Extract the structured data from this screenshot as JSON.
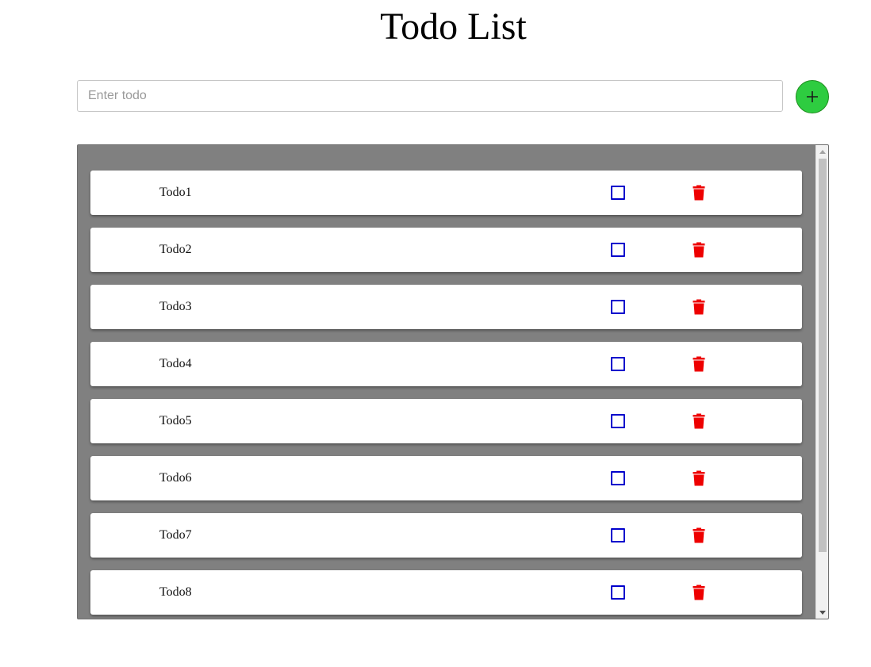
{
  "page": {
    "title": "Todo List"
  },
  "input": {
    "placeholder": "Enter todo",
    "value": ""
  },
  "add_button": {
    "icon": "plus-icon",
    "color": "#2ecc40"
  },
  "todos": [
    {
      "label": "Todo1",
      "done": false
    },
    {
      "label": "Todo2",
      "done": false
    },
    {
      "label": "Todo3",
      "done": false
    },
    {
      "label": "Todo4",
      "done": false
    },
    {
      "label": "Todo5",
      "done": false
    },
    {
      "label": "Todo6",
      "done": false
    },
    {
      "label": "Todo7",
      "done": false
    },
    {
      "label": "Todo8",
      "done": false
    }
  ],
  "colors": {
    "panel_background": "#808080",
    "checkbox_border": "#0000cc",
    "delete_icon": "#ee0000",
    "add_button": "#2ecc40"
  },
  "icons": {
    "checkbox": "checkbox-icon",
    "delete": "trash-icon"
  }
}
